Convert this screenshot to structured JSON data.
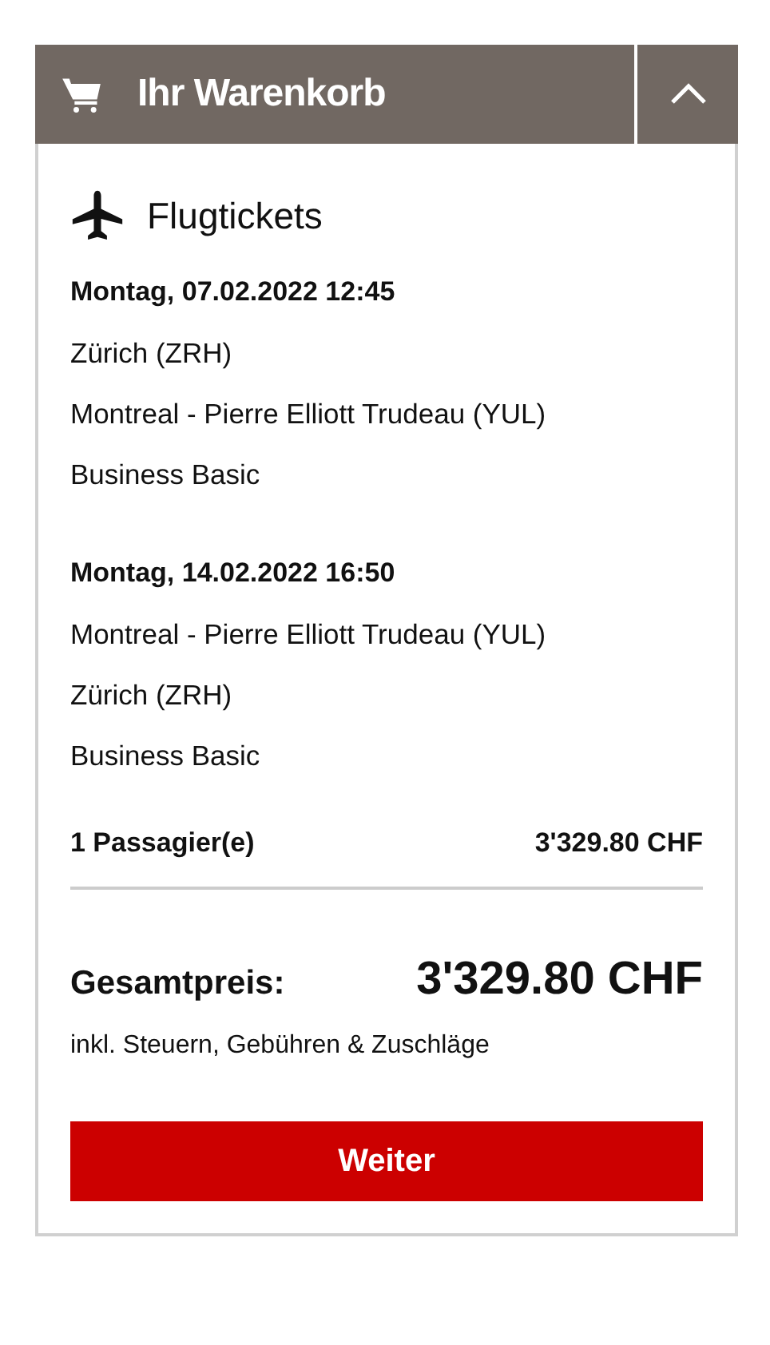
{
  "cart": {
    "title": "Ihr Warenkorb",
    "expanded": true
  },
  "section": {
    "title": "Flugtickets"
  },
  "flights": [
    {
      "date": "Montag, 07.02.2022 12:45",
      "from": "Zürich (ZRH)",
      "to": "Montreal - Pierre Elliott Trudeau (YUL)",
      "fare": "Business Basic"
    },
    {
      "date": "Montag, 14.02.2022 16:50",
      "from": "Montreal - Pierre Elliott Trudeau (YUL)",
      "to": "Zürich (ZRH)",
      "fare": "Business Basic"
    }
  ],
  "passengers": {
    "label": "1 Passagier(e)",
    "price": "3'329.80 CHF"
  },
  "total": {
    "label": "Gesamtpreis:",
    "price": "3'329.80 CHF",
    "note": "inkl. Steuern, Gebühren & Zuschläge"
  },
  "button": "Weiter"
}
